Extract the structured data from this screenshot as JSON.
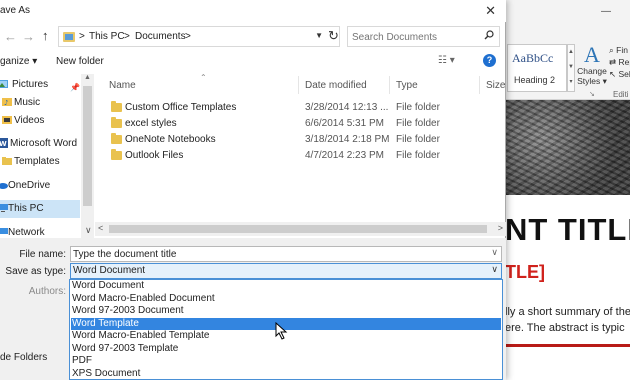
{
  "word_bg": {
    "window_controls": "—",
    "styles": {
      "sample": "AaBbCc",
      "heading_label": "Heading 2"
    },
    "change_styles": {
      "glyph": "A",
      "label_line1": "Change",
      "label_line2": "Styles ▾"
    },
    "editing": {
      "find": "Fin",
      "replace": "Rep",
      "select": "Sel",
      "group": "Editi"
    },
    "document": {
      "title": "NT TITLE",
      "subtitle": "TLE]",
      "abstract_line1": "lly a short summary of the",
      "abstract_line2": "ere. The abstract is typic"
    }
  },
  "dialog": {
    "title": "ave As",
    "nav": {
      "back": "←",
      "forward": "→",
      "up": "↑",
      "breadcrumbs": [
        "This PC",
        "Documents"
      ],
      "separator": ">",
      "refresh": "↻",
      "search_placeholder": "Search Documents"
    },
    "toolbar": {
      "organize": "ganize ▾",
      "new_folder": "New folder",
      "views": "☷ ▾",
      "help": "?"
    },
    "nav_pane": {
      "items": [
        {
          "label": "Pictures",
          "icon": "pictures-icon",
          "pinned": true
        },
        {
          "label": "Music",
          "icon": "music-icon"
        },
        {
          "label": "Videos",
          "icon": "videos-icon"
        },
        {
          "label": "Microsoft Word",
          "icon": "word-icon"
        },
        {
          "label": "Templates",
          "icon": "folder-icon"
        },
        {
          "label": "OneDrive",
          "icon": "onedrive-icon"
        },
        {
          "label": "This PC",
          "icon": "computer-icon",
          "selected": true
        },
        {
          "label": "Network",
          "icon": "network-icon"
        }
      ]
    },
    "columns": {
      "name": "Name",
      "date": "Date modified",
      "type": "Type",
      "size": "Size"
    },
    "files": [
      {
        "name": "Custom Office Templates",
        "date": "3/28/2014 12:13 ...",
        "type": "File folder"
      },
      {
        "name": "excel styles",
        "date": "6/6/2014 5:31 PM",
        "type": "File folder"
      },
      {
        "name": "OneNote Notebooks",
        "date": "3/18/2014 2:18 PM",
        "type": "File folder"
      },
      {
        "name": "Outlook Files",
        "date": "4/7/2014 2:23 PM",
        "type": "File folder"
      }
    ],
    "form": {
      "file_name_label": "File name:",
      "file_name_value": "Type the document title",
      "save_as_type_label": "Save as type:",
      "save_as_type_value": "Word Document",
      "authors_label": "Authors:",
      "hide_folders": "de Folders"
    },
    "type_options": [
      "Word Document",
      "Word Macro-Enabled Document",
      "Word 97-2003 Document",
      "Word Template",
      "Word Macro-Enabled Template",
      "Word 97-2003 Template",
      "PDF",
      "XPS Document"
    ],
    "highlighted_option_index": 3
  },
  "colors": {
    "accent_blue": "#3385e0",
    "selection_bg": "#cce4f7",
    "folder_yellow": "#e9c24e",
    "doc_red": "#d0221c"
  }
}
